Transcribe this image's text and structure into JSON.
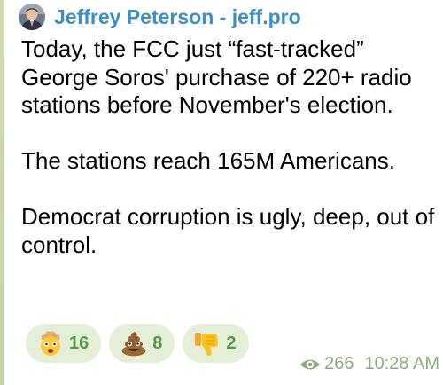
{
  "post": {
    "sender_name": "Jeffrey Peterson - jeff.pro",
    "paragraphs": [
      "Today, the FCC just “fast-tracked” George Soros' purchase of 220+ radio stations before November's election.",
      "The stations reach 165M Americans.",
      "Democrat corruption is ugly, deep, out of control."
    ]
  },
  "reactions": [
    {
      "icon": "exploding-head-icon",
      "count": "16"
    },
    {
      "icon": "pile-of-poo-icon",
      "count": "8"
    },
    {
      "icon": "thumbs-down-icon",
      "count": "2"
    }
  ],
  "meta": {
    "views_icon": "eye-icon",
    "views": "266",
    "time": "10:28 AM"
  },
  "colors": {
    "sender": "#3a8ec9",
    "reaction_bg": "#e3efd7",
    "reaction_count": "#4f9a3e",
    "meta_text": "#8cab7a"
  }
}
